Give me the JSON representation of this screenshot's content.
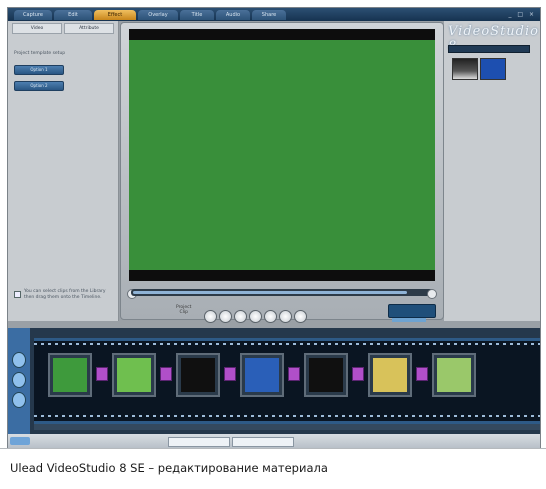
{
  "window": {
    "tabs": [
      "Capture",
      "Edit",
      "Effect",
      "Overlay",
      "Title",
      "Audio",
      "Share"
    ],
    "active_tab": "Effect",
    "controls": "_ □ ×"
  },
  "left_panel": {
    "tabs": [
      "Video",
      "Attribute"
    ],
    "label": "Project template setup",
    "buttons": [
      "Option 1",
      "Option 2"
    ],
    "tip": "You can select clips from the Library then drag them onto the Timeline."
  },
  "brand": {
    "text": "VideoStudio 8"
  },
  "preview": {
    "project_label": "Project\nClip",
    "progress": 0.92
  },
  "timeline": {
    "clips": [
      {
        "color": "#3e9a3c"
      },
      {
        "color": "#6fbf4f"
      },
      {
        "color": "#101010"
      },
      {
        "color": "#2a5fb8"
      },
      {
        "color": "#101010"
      },
      {
        "color": "#d8c25a"
      },
      {
        "color": "#9ac86a"
      }
    ]
  },
  "caption": {
    "text": "Ulead VideoStudio 8 SE – редактирование материала"
  }
}
